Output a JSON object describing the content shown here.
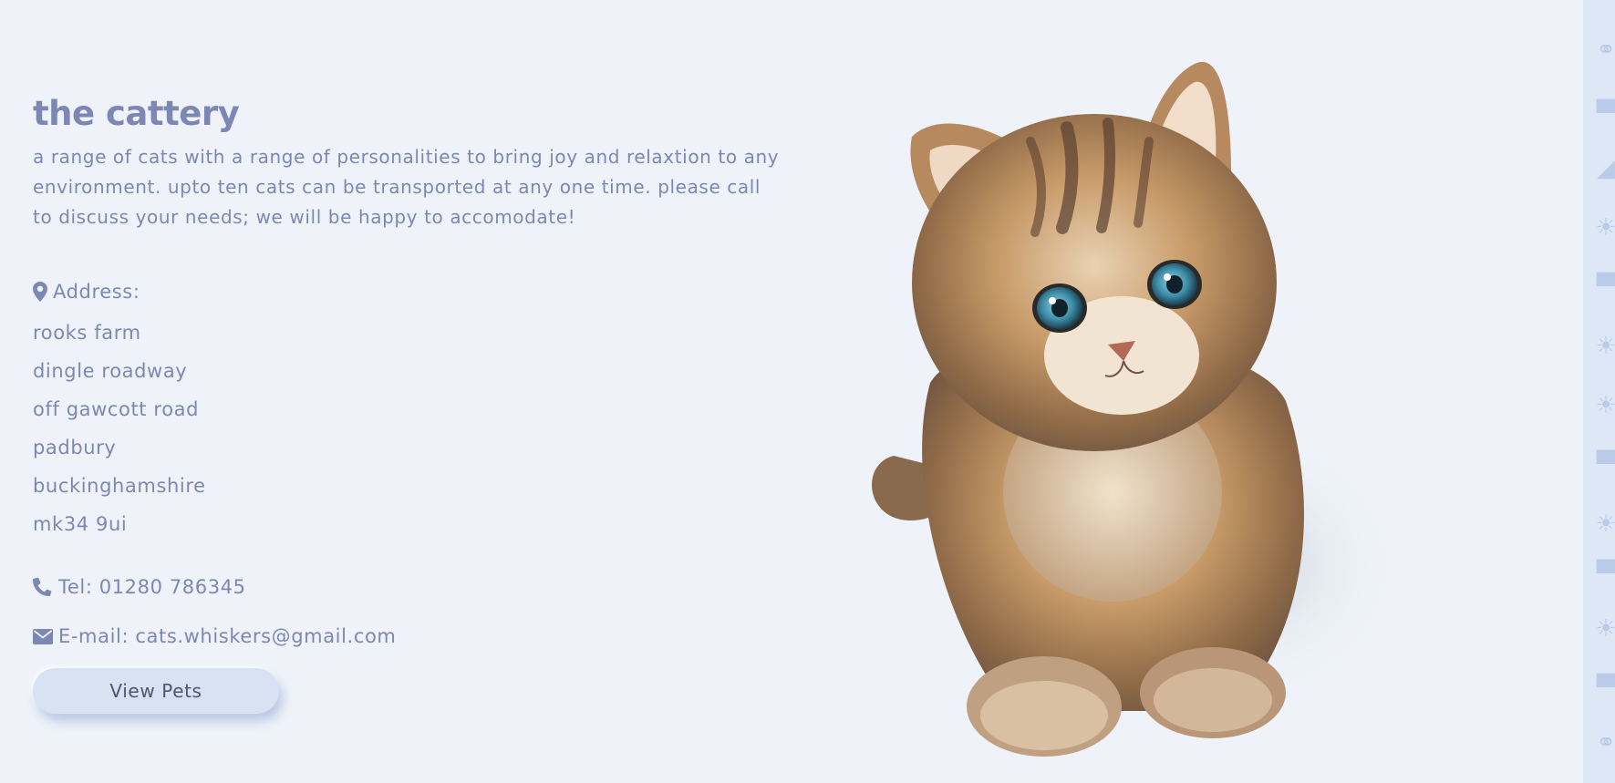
{
  "section": {
    "title": "the cattery",
    "description": "a range of cats with a range of personalities to bring joy and relaxtion to any environment. upto ten cats can be transported at any one time. please call to discuss your needs; we will be happy to accomodate!"
  },
  "address": {
    "heading": "Address:",
    "lines": [
      "rooks farm",
      "dingle roadway",
      "off gawcott road",
      "padbury",
      "buckinghamshire",
      "mk34 9ui"
    ]
  },
  "contact": {
    "tel": "Tel: 01280 786345",
    "email": "E-mail: cats.whiskers@gmail.com"
  },
  "button": {
    "label": "View Pets"
  },
  "icons": {
    "address": "map-marker-icon",
    "tel": "phone-icon",
    "email": "envelope-icon"
  },
  "colors": {
    "background": "#eff3f9",
    "text": "#7c88b3",
    "button": "#d8e2f2",
    "strip": "#dde7f6"
  }
}
